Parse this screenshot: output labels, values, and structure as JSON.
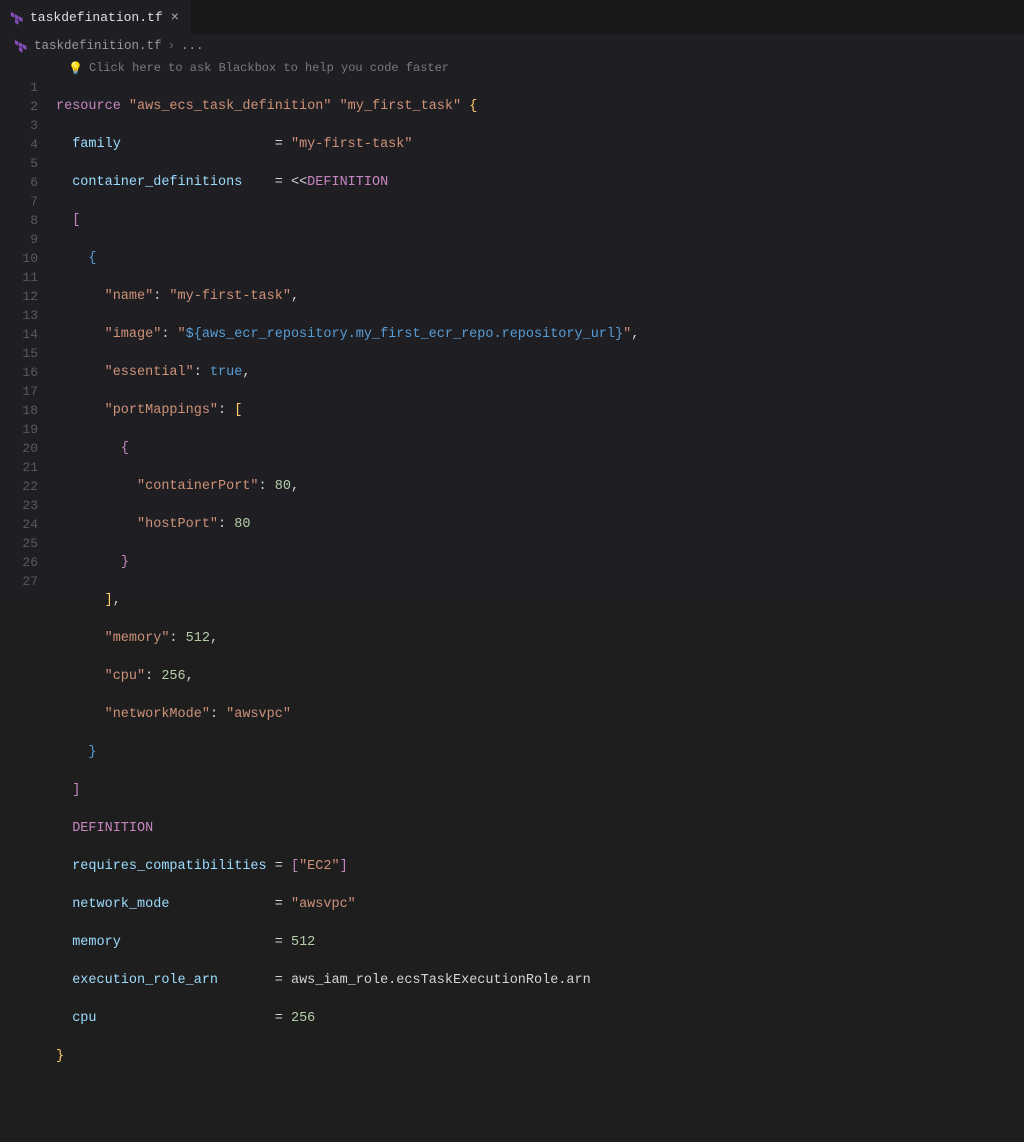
{
  "tab": {
    "label": "taskdefination.tf"
  },
  "breadcrumb": {
    "file": "taskdefinition.tf",
    "sep": "›",
    "tail": "..."
  },
  "hint": {
    "text": "Click here to ask Blackbox to help you code faster"
  },
  "code": {
    "resource_kw": "resource",
    "resource_type": "\"aws_ecs_task_definition\"",
    "resource_name": "\"my_first_task\"",
    "family_attr": "family",
    "family_val": "\"my-first-task\"",
    "cd_attr": "container_definitions",
    "heredoc_open_op": "<<",
    "heredoc_tag": "DEFINITION",
    "name_key": "\"name\"",
    "name_val": "\"my-first-task\"",
    "image_key": "\"image\"",
    "image_val_prefix": "\"",
    "image_interp": "${aws_ecr_repository.my_first_ecr_repo.repository_url}",
    "image_val_suffix": "\"",
    "essential_key": "\"essential\"",
    "essential_val": "true",
    "pm_key": "\"portMappings\"",
    "cport_key": "\"containerPort\"",
    "cport_val": "80",
    "hport_key": "\"hostPort\"",
    "hport_val": "80",
    "memory_key": "\"memory\"",
    "memory_val": "512",
    "cpu_key": "\"cpu\"",
    "cpu_val": "256",
    "nm_key": "\"networkMode\"",
    "nm_val": "\"awsvpc\"",
    "rc_attr": "requires_compatibilities",
    "rc_val": "\"EC2\"",
    "netmode_attr": "network_mode",
    "netmode_val": "\"awsvpc\"",
    "mem_attr": "memory",
    "mem_num": "512",
    "era_attr": "execution_role_arn",
    "era_val": "aws_iam_role.ecsTaskExecutionRole.arn",
    "cpu_attr": "cpu",
    "cpu_num": "256"
  },
  "lines": [
    "1",
    "2",
    "3",
    "4",
    "5",
    "6",
    "7",
    "8",
    "9",
    "10",
    "11",
    "12",
    "13",
    "14",
    "15",
    "16",
    "17",
    "18",
    "19",
    "20",
    "21",
    "22",
    "23",
    "24",
    "25",
    "26",
    "27"
  ]
}
